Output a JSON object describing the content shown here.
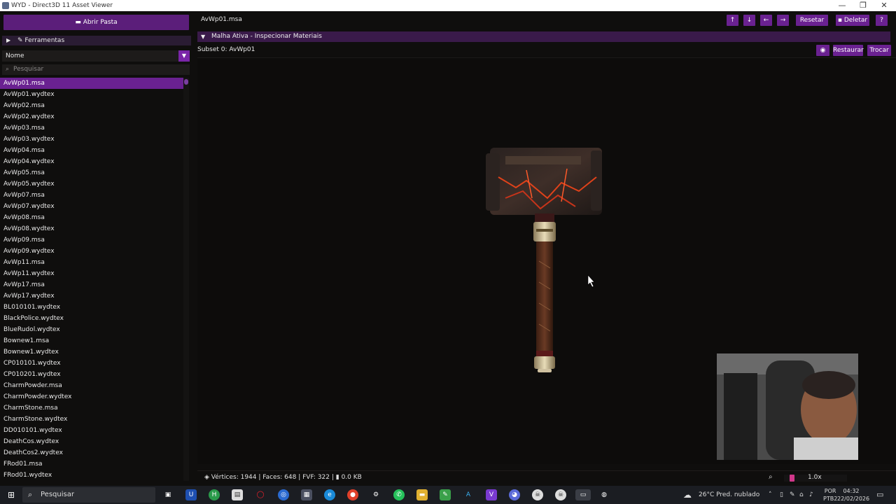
{
  "window": {
    "title": "WYD - Direct3D 11 Asset Viewer",
    "minimize": "—",
    "maximize": "❐",
    "close": "✕"
  },
  "sidebar": {
    "open_folder_label": "Abrir Pasta",
    "tools_label": "Ferramentas",
    "sort_label": "Nome",
    "search_placeholder": "Pesquisar",
    "files": [
      "AvWp01.msa",
      "AvWp01.wydtex",
      "AvWp02.msa",
      "AvWp02.wydtex",
      "AvWp03.msa",
      "AvWp03.wydtex",
      "AvWp04.msa",
      "AvWp04.wydtex",
      "AvWp05.msa",
      "AvWp05.wydtex",
      "AvWp07.msa",
      "AvWp07.wydtex",
      "AvWp08.msa",
      "AvWp08.wydtex",
      "AvWp09.msa",
      "AvWp09.wydtex",
      "AvWp11.msa",
      "AvWp11.wydtex",
      "AvWp17.msa",
      "AvWp17.wydtex",
      "BL010101.wydtex",
      "BlackPolice.wydtex",
      "BlueRudol.wydtex",
      "Bownew1.msa",
      "Bownew1.wydtex",
      "CP010101.wydtex",
      "CP010201.wydtex",
      "CharmPowder.msa",
      "CharmPowder.wydtex",
      "CharmStone.msa",
      "CharmStone.wydtex",
      "DD010101.wydtex",
      "DeathCos.wydtex",
      "DeathCos2.wydtex",
      "FRod01.msa",
      "FRod01.wydtex"
    ],
    "selected_index": 0
  },
  "toolbar": {
    "current_file": "AvWp01.msa",
    "up": "↑",
    "down": "↓",
    "left": "←",
    "right": "→",
    "reset_label": "Resetar",
    "delete_label": "Deletar",
    "help_label": "?"
  },
  "panel": {
    "section_title": "Malha Ativa - Inspecionar Materiais",
    "subset_label": "Subset 0: AvWp01",
    "restore_label": "Restaurar",
    "swap_label": "Trocar"
  },
  "status": {
    "stats": "Vértices: 1944 | Faces: 648 | FVF: 322 |",
    "size": "0.0 KB",
    "zoom": "1.0x",
    "zoom_fraction": 0.05
  },
  "taskbar": {
    "search_label": "Pesquisar",
    "weather": "26°C  Pred. nublado",
    "lang_line1": "POR",
    "lang_line2": "PTB2",
    "time": "04:32",
    "date": "22/02/2026"
  }
}
